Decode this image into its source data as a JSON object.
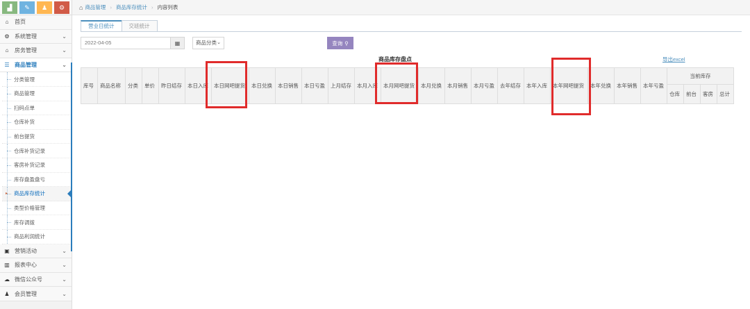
{
  "sidebar": {
    "shortcuts": [
      {
        "icon": "bar-chart-icon",
        "color": "#87b87f",
        "glyph": "▟"
      },
      {
        "icon": "pencil-icon",
        "color": "#6fb3e0",
        "glyph": "✎"
      },
      {
        "icon": "users-icon",
        "color": "#ffb752",
        "glyph": "♟"
      },
      {
        "icon": "cogs-icon",
        "color": "#d15b47",
        "glyph": "⚙"
      }
    ],
    "menu_top": [
      {
        "label": "首页",
        "icon": "home-icon",
        "glyph": "⌂",
        "has_chevron": false
      },
      {
        "label": "系统管理",
        "icon": "gear-icon",
        "glyph": "⚙",
        "has_chevron": true
      },
      {
        "label": "房务管理",
        "icon": "bank-icon",
        "glyph": "🏛",
        "has_chevron": true
      }
    ],
    "open_menu": {
      "label": "商品管理",
      "icon": "list-icon",
      "glyph": "☰"
    },
    "sub_items": [
      {
        "label": "分类管理"
      },
      {
        "label": "商品管理"
      },
      {
        "label": "扫码点单"
      },
      {
        "label": "仓库补货"
      },
      {
        "label": "前台提货"
      },
      {
        "label": "仓库补货记录"
      },
      {
        "label": "客房补货记录"
      },
      {
        "label": "库存盘盈盘亏"
      },
      {
        "label": "商品库存统计"
      },
      {
        "label": "类型价格管理"
      },
      {
        "label": "库存调拨"
      },
      {
        "label": "商品利润统计"
      }
    ],
    "active_sub_index": 8,
    "menu_bottom": [
      {
        "label": "营销活动",
        "icon": "gift-icon",
        "glyph": "🎁"
      },
      {
        "label": "报表中心",
        "icon": "bar-chart-icon",
        "glyph": "▥"
      },
      {
        "label": "微信公众号",
        "icon": "cloud-icon",
        "glyph": "☁"
      },
      {
        "label": "会员管理",
        "icon": "group-icon",
        "glyph": "👥"
      }
    ]
  },
  "breadcrumbs": {
    "items": [
      "商品管理",
      "商品库存统计"
    ],
    "current": "内容列表"
  },
  "tabs": [
    {
      "label": "营业日统计",
      "active": true
    },
    {
      "label": "交班统计",
      "active": false
    }
  ],
  "filters": {
    "date_value": "2022-04-05",
    "category_select": "商品分类",
    "query_button": "查询"
  },
  "table": {
    "title": "商品库存盘点",
    "export_label": "导出excel",
    "columns": [
      "库号",
      "商品名称",
      "分类",
      "单价",
      "昨日结存",
      "本日入库",
      "本日网吧提货",
      "本日兑换",
      "本日销售",
      "本日亏盈",
      "上月结存",
      "本月入库",
      "本月网吧提货",
      "本月兑换",
      "本月销售",
      "本月亏盈",
      "去年结存",
      "本年入库",
      "本年网吧提货",
      "本年兑换",
      "本年销售",
      "本年亏盈"
    ],
    "group_header": "当前库存",
    "group_columns": [
      "仓库",
      "前台",
      "客房",
      "总计"
    ]
  },
  "highlights": [
    "本日网吧提货",
    "本月网吧提货",
    "本年网吧提货"
  ],
  "colors": {
    "accent": "#4c8fbd",
    "query_button": "#9585bf",
    "highlight_box": "#e02b2b"
  }
}
